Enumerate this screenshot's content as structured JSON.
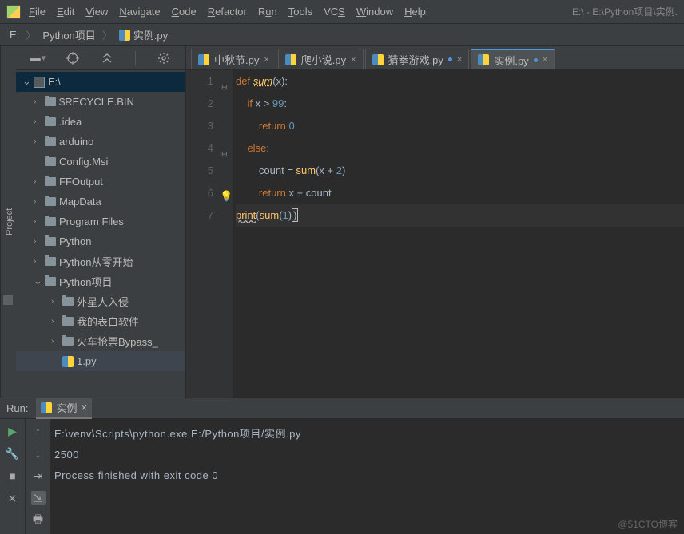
{
  "title_path": "E:\\ - E:\\Python项目\\实例.",
  "menu": [
    "File",
    "Edit",
    "View",
    "Navigate",
    "Code",
    "Refactor",
    "Run",
    "Tools",
    "VCS",
    "Window",
    "Help"
  ],
  "breadcrumb": {
    "root": "E:",
    "folder": "Python项目",
    "file": "实例.py"
  },
  "project_tree": {
    "root": "E:\\",
    "items": [
      {
        "name": "$RECYCLE.BIN",
        "expandable": true
      },
      {
        "name": ".idea",
        "expandable": true
      },
      {
        "name": "arduino",
        "expandable": true
      },
      {
        "name": "Config.Msi",
        "expandable": false
      },
      {
        "name": "FFOutput",
        "expandable": true
      },
      {
        "name": "MapData",
        "expandable": true
      },
      {
        "name": "Program Files",
        "expandable": true
      },
      {
        "name": "Python",
        "expandable": true
      },
      {
        "name": "Python从零开始",
        "expandable": true
      }
    ],
    "open_folder": "Python项目",
    "children": [
      {
        "name": "外星人入侵"
      },
      {
        "name": "我的表白软件"
      },
      {
        "name": "火车抢票Bypass_"
      }
    ],
    "file_child": "1.py"
  },
  "tabs": [
    {
      "label": "中秋节.py",
      "active": false
    },
    {
      "label": "爬小说.py",
      "active": false
    },
    {
      "label": "猜拳游戏.py",
      "active": false,
      "modified": true
    },
    {
      "label": "实例.py",
      "active": true,
      "modified": true
    }
  ],
  "code": {
    "lines": [
      "1",
      "2",
      "3",
      "4",
      "5",
      "6",
      "7"
    ],
    "src": {
      "l1_def": "def ",
      "l1_fn": "sum",
      "l1_rest": "(x):",
      "l2_if": "if ",
      "l2_cond": "x > ",
      "l2_num": "99",
      "l2_col": ":",
      "l3_ret": "return ",
      "l3_num": "0",
      "l4_else": "else",
      "l5_id": "count = ",
      "l5_fn": "sum",
      "l5_paro": "(x + ",
      "l5_num": "2",
      "l5_parc": ")",
      "l6_ret": "return ",
      "l6_rest": "x + count",
      "l7_fn": "print",
      "l7_par": "(",
      "l7_call": "sum",
      "l7_arg": "(",
      "l7_num": "1",
      "l7_end": "))"
    }
  },
  "run": {
    "label": "Run:",
    "tab": "实例",
    "output": [
      "E:\\venv\\Scripts\\python.exe E:/Python项目/实例.py",
      "2500",
      "",
      "Process finished with exit code 0"
    ]
  },
  "watermark": "@51CTO博客"
}
